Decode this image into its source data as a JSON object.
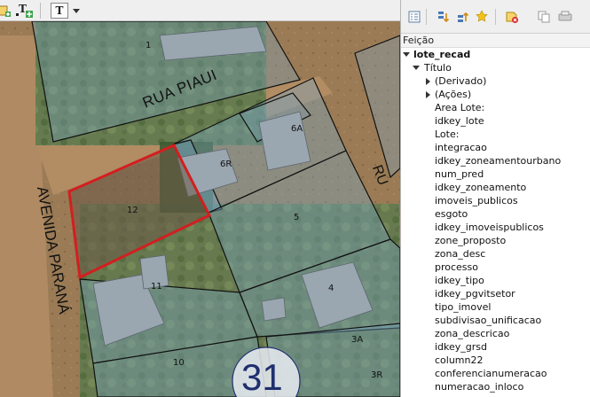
{
  "toolbar": {
    "text_tool_glyph": "T",
    "text_tool_glyph2": "T",
    "icons": [
      "add-feature-icon",
      "add-text-label-icon",
      "text-annotation-icon",
      "dropdown-arrow-icon"
    ]
  },
  "map": {
    "street_labels": {
      "rua_piaui": "RUA PIAUI",
      "avenida_parana": "AVENIDA PARANÁ",
      "right_street_partial": "RU"
    },
    "lot_labels": {
      "lot_1": "1",
      "lot_6a": "6A",
      "lot_6r": "6R",
      "lot_12": "12",
      "lot_5": "5",
      "lot_11": "11",
      "lot_4": "4",
      "lot_3a": "3A",
      "lot_10": "10",
      "lot_3r": "3R"
    },
    "block_number": "31",
    "colors": {
      "selection_outline": "#d21f1f",
      "parcel_line": "#111111",
      "parcel_fill": "#7aa7c7"
    }
  },
  "panel": {
    "toolbar_icons": [
      "expand-tree-icon",
      "expand-all-icon",
      "collapse-all-icon",
      "highlight-feature-icon",
      "clear-results-icon",
      "copy-icon",
      "print-icon"
    ],
    "feature_header": "Feição",
    "tree": {
      "layer": "lote_recad",
      "feature": "Título",
      "groups": [
        "(Derivado)",
        "(Ações)"
      ],
      "attributes": [
        "Area Lote:",
        "idkey_lote",
        "Lote:",
        "integracao",
        "idkey_zoneamentourbano",
        "num_pred",
        "idkey_zoneamento",
        "imoveis_publicos",
        "esgoto",
        "idkey_imoveispublicos",
        "zone_proposto",
        "zona_desc",
        "processo",
        "idkey_tipo",
        "idkey_pgvitsetor",
        "tipo_imovel",
        "subdivisao_unificacao",
        "zona_descricao",
        "idkey_grsd",
        "column22",
        "conferencianumeracao",
        "numeracao_inloco"
      ]
    }
  }
}
